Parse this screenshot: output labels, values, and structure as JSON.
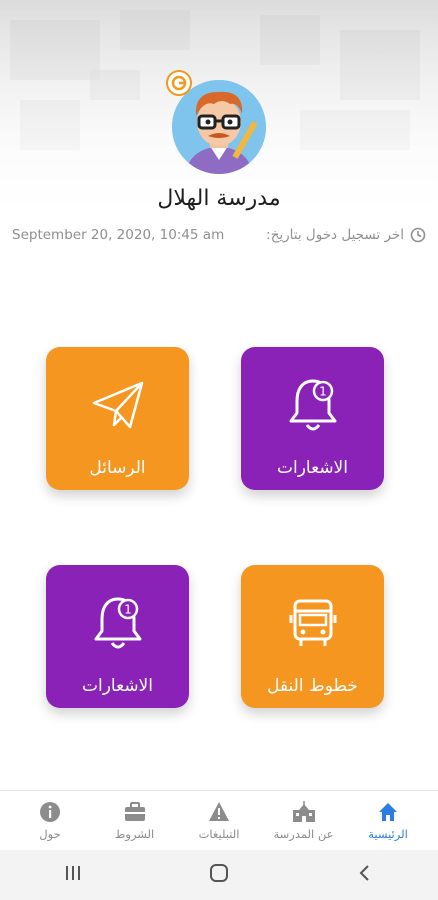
{
  "header": {
    "school_name": "مدرسة الهلال",
    "last_login_label": "اخر تسجيل دخول بتاريخ:",
    "last_login_value": "September 20, 2020, 10:45 am"
  },
  "tiles": [
    {
      "label": "الرسائل",
      "icon": "paper-plane-icon",
      "color": "#f4961f"
    },
    {
      "label": "الاشعارات",
      "icon": "bell-icon",
      "badge": "1",
      "color": "#8a22b8"
    },
    {
      "label": "الاشعارات",
      "icon": "bell-icon",
      "badge": "1",
      "color": "#8a22b8"
    },
    {
      "label": "خطوط النقل",
      "icon": "bus-icon",
      "color": "#f4961f"
    }
  ],
  "bottom_nav": {
    "items": [
      {
        "label": "الرئيسية",
        "icon": "home-icon",
        "active": true
      },
      {
        "label": "عن المدرسة",
        "icon": "school-icon"
      },
      {
        "label": "التبليغات",
        "icon": "warning-icon"
      },
      {
        "label": "الشروط",
        "icon": "briefcase-icon"
      },
      {
        "label": "حول",
        "icon": "info-icon"
      }
    ]
  },
  "colors": {
    "accent": "#2a7de1",
    "orange": "#f4961f",
    "purple": "#8a22b8"
  }
}
